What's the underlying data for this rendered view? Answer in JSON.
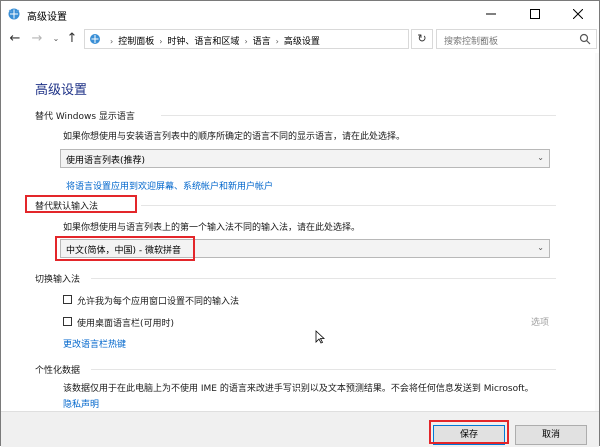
{
  "window": {
    "title": "高级设置",
    "min_icon": "minimize-icon",
    "max_icon": "maximize-icon",
    "close_icon": "close-icon"
  },
  "address_bar": {
    "breadcrumbs": [
      "控制面板",
      "时钟、语言和区域",
      "语言",
      "高级设置"
    ],
    "search_placeholder": "搜索控制面板",
    "refresh_icon": "refresh-icon"
  },
  "content": {
    "heading": "高级设置",
    "display_language": {
      "title": "替代 Windows 显示语言",
      "description": "如果你想使用与安装语言列表中的顺序所确定的语言不同的显示语言，请在此处选择。",
      "selected": "使用语言列表(推荐)",
      "link": "将语言设置应用到欢迎屏幕、系统帐户和新用户帐户"
    },
    "input_method": {
      "title": "替代默认输入法",
      "description": "如果你想使用与语言列表上的第一个输入法不同的输入法，请在此处选择。",
      "selected": "中文(简体，中国) - 微软拼音"
    },
    "switch_input": {
      "title": "切换输入法",
      "option1": "允许我为每个应用窗口设置不同的输入法",
      "option1_checked": false,
      "option2": "使用桌面语言栏(可用时)",
      "option2_checked": false,
      "options_label": "选项",
      "hotkey_link": "更改语言栏热键"
    },
    "personalization": {
      "title": "个性化数据",
      "description": "该数据仅用于在此电脑上为不使用 IME 的语言来改进手写识别以及文本预测结果。不会将任何信息发送到 Microsoft。",
      "privacy_link": "隐私声明"
    }
  },
  "footer": {
    "save_label": "保存",
    "cancel_label": "取消"
  },
  "colors": {
    "heading": "#1e3287",
    "link": "#0066cc",
    "highlight": "#e3262a"
  }
}
